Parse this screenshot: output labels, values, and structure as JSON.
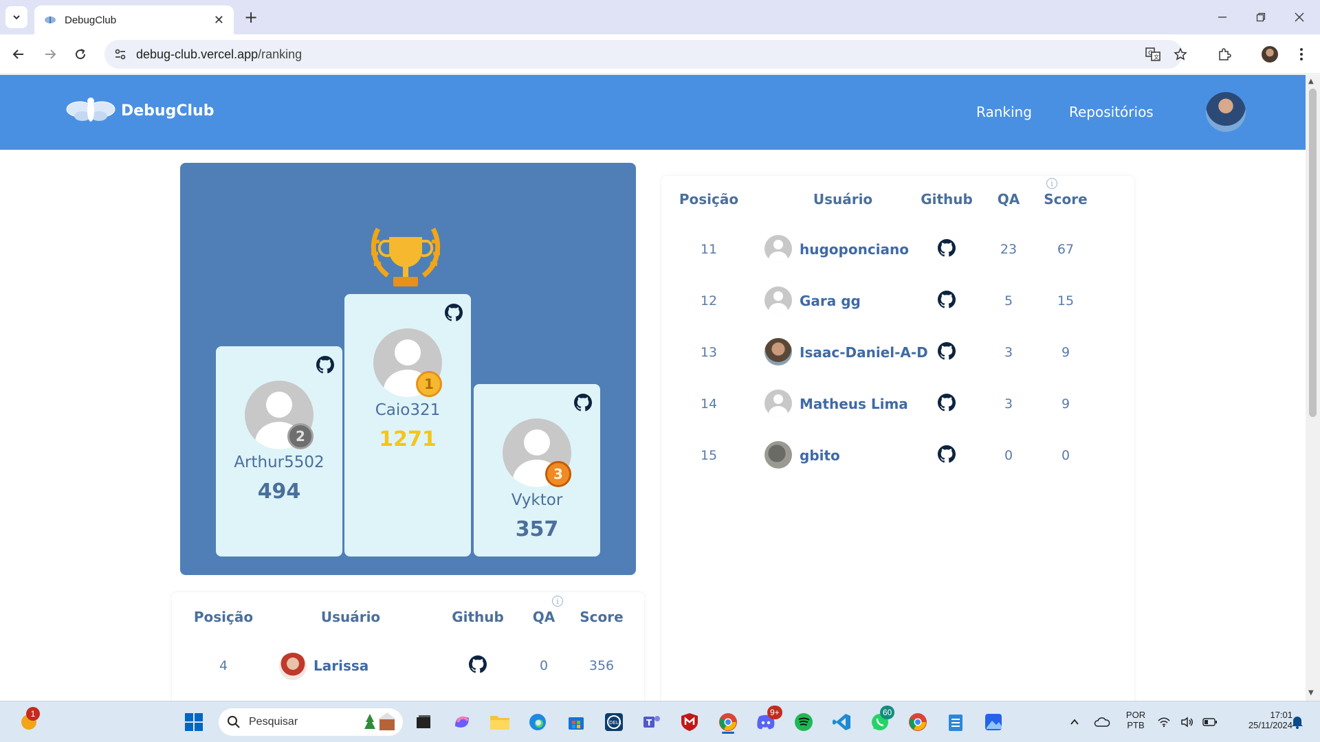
{
  "browser": {
    "tab_title": "DebugClub",
    "url_host": "debug-club.vercel.app",
    "url_path": "/ranking"
  },
  "site": {
    "brand": "DebugClub",
    "nav": [
      "Ranking",
      "Repositórios"
    ],
    "accent_color": "#4a90e2",
    "panel_color": "#4f7fb6"
  },
  "podium": [
    {
      "place": 2,
      "name": "Arthur5502",
      "score": "494"
    },
    {
      "place": 1,
      "name": "Caio321",
      "score": "1271"
    },
    {
      "place": 3,
      "name": "Vyktor",
      "score": "357"
    }
  ],
  "table_headers": {
    "position": "Posição",
    "user": "Usuário",
    "github": "Github",
    "qa": "QA",
    "score": "Score"
  },
  "left_table_rows": [
    {
      "position": "4",
      "user": "Larissa",
      "qa": "0",
      "score": "356"
    }
  ],
  "right_table_rows": [
    {
      "position": "11",
      "user": "hugoponciano",
      "qa": "23",
      "score": "67"
    },
    {
      "position": "12",
      "user": "Gara gg",
      "qa": "5",
      "score": "15"
    },
    {
      "position": "13",
      "user": "Isaac-Daniel-A-D",
      "qa": "3",
      "score": "9"
    },
    {
      "position": "14",
      "user": "Matheus Lima",
      "qa": "3",
      "score": "9"
    },
    {
      "position": "15",
      "user": "gbito",
      "qa": "0",
      "score": "0"
    }
  ],
  "taskbar": {
    "search_placeholder": "Pesquisar",
    "notification_badge": "1",
    "discord_badge": "9+",
    "whatsapp_badge": "60",
    "language": "POR",
    "keyboard": "PTB",
    "time": "17:01",
    "date": "25/11/2024"
  }
}
